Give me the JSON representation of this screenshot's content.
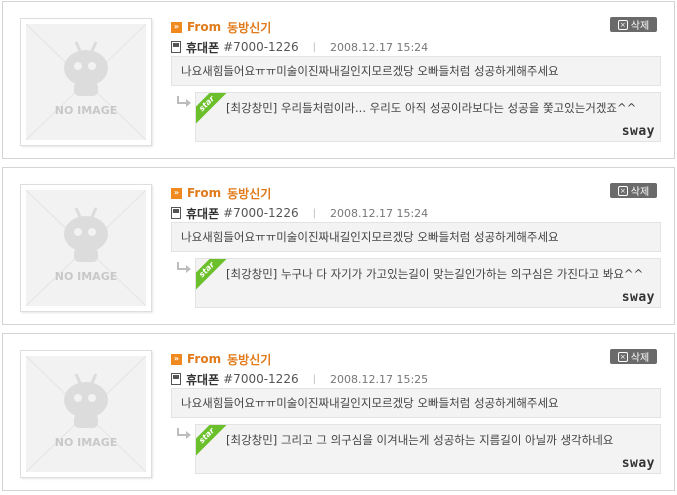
{
  "entries": [
    {
      "thumb_text": "NO IMAGE",
      "from_label": "From",
      "from_name": "동방신기",
      "phone_label": "휴대폰",
      "phone_number": "#7000-1226",
      "separator": "|",
      "date": "2008.12.17 15:24",
      "delete_label": "삭제",
      "message": "나요새힘들어요ㅠㅠ미술이진짜내길인지모르겠당 오빠들처럼 성공하게해주세요",
      "star_badge": "star",
      "reply": "[최강창민] 우리들처럼이라... 우리도 아직 성공이라보다는 성공을 쫓고있는거겠죠^^",
      "signature": "sway"
    },
    {
      "thumb_text": "NO IMAGE",
      "from_label": "From",
      "from_name": "동방신기",
      "phone_label": "휴대폰",
      "phone_number": "#7000-1226",
      "separator": "|",
      "date": "2008.12.17 15:24",
      "delete_label": "삭제",
      "message": "나요새힘들어요ㅠㅠ미술이진짜내길인지모르겠당 오빠들처럼 성공하게해주세요",
      "star_badge": "star",
      "reply": "[최강창민] 누구나 다 자기가 가고있는길이 맞는길인가하는 의구심은 가진다고 봐요^^",
      "signature": "sway"
    },
    {
      "thumb_text": "NO IMAGE",
      "from_label": "From",
      "from_name": "동방신기",
      "phone_label": "휴대폰",
      "phone_number": "#7000-1226",
      "separator": "|",
      "date": "2008.12.17 15:25",
      "delete_label": "삭제",
      "message": "나요새힘들어요ㅠㅠ미술이진짜내길인지모르겠당 오빠들처럼 성공하게해주세요",
      "star_badge": "star",
      "reply": "[최강창민] 그리고 그 의구심을 이겨내는게 성공하는 지름길이 아닐까 생각하네요",
      "signature": "sway"
    }
  ]
}
